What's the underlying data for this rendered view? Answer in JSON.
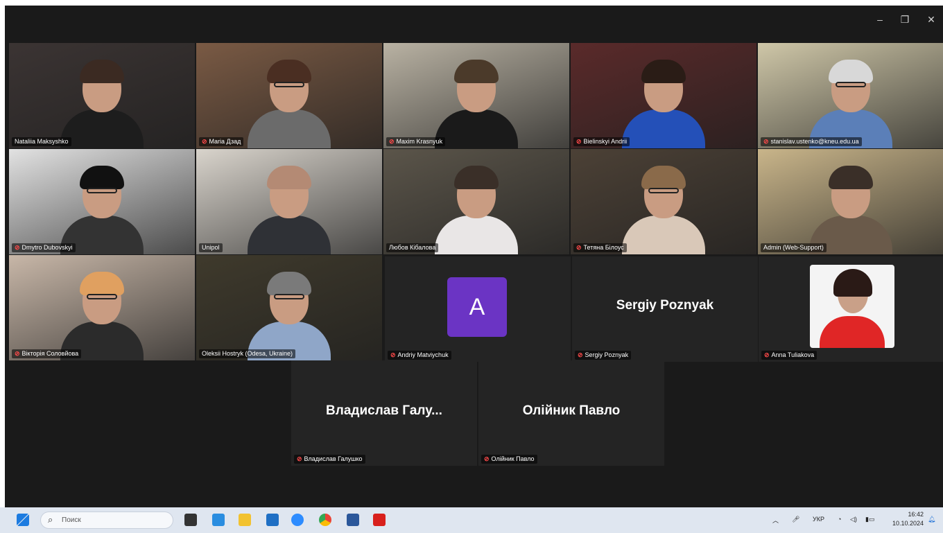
{
  "window": {
    "controls": [
      "–",
      "❐",
      "✕"
    ]
  },
  "participants": [
    {
      "name": "Nataliia Maksyshko",
      "muted": false,
      "active": false,
      "bg": "#3b3433",
      "hair": "#3b2a22",
      "shirt": "#1d1d1d",
      "glasses": false
    },
    {
      "name": "Maria Дзад",
      "muted": true,
      "active": false,
      "bg": "#7a5a44",
      "hair": "#4a2e22",
      "shirt": "#6b6b6b",
      "glasses": true
    },
    {
      "name": "Maxim Krasnyuk",
      "muted": true,
      "active": false,
      "bg": "#b9b2a3",
      "hair": "#4b3a2a",
      "shirt": "#1a1a1a",
      "glasses": false
    },
    {
      "name": "Bielinskyi Andrii",
      "muted": true,
      "active": false,
      "bg": "#5a2a2a",
      "hair": "#2a1c16",
      "shirt": "#2450b8",
      "glasses": false
    },
    {
      "name": "stanislav.ustenko@kneu.edu.ua",
      "muted": true,
      "active": false,
      "bg": "#cfc7a8",
      "hair": "#d8d8d8",
      "shirt": "#5b7fb8",
      "glasses": true
    },
    {
      "name": "Dmytro Dubovskyi",
      "muted": true,
      "active": false,
      "bg": "#e2e2e2",
      "hair": "#111111",
      "shirt": "#333333",
      "glasses": true
    },
    {
      "name": "Unipol",
      "muted": false,
      "active": true,
      "bg": "#d9d4cc",
      "hair": "#b48a74",
      "shirt": "#2f3136",
      "glasses": false
    },
    {
      "name": "Любов Кібалова",
      "muted": false,
      "active": false,
      "bg": "#5b554a",
      "hair": "#3a2f28",
      "shirt": "#e9e6e6",
      "glasses": false
    },
    {
      "name": "Тетяна Білоус",
      "muted": true,
      "active": false,
      "bg": "#4c4136",
      "hair": "#8a6a4a",
      "shirt": "#d9c8b8",
      "glasses": true
    },
    {
      "name": "Admin (Web-Support)",
      "muted": false,
      "active": false,
      "bg": "#c9b58a",
      "hair": "#3a2f28",
      "shirt": "#6a5a4a",
      "glasses": false
    },
    {
      "name": "Вікторія Соловйова",
      "muted": true,
      "active": false,
      "bg": "#c8b7a8",
      "hair": "#e0a060",
      "shirt": "#2b2b2b",
      "glasses": true
    },
    {
      "name": "Oleksii Hostryk (Odesa, Ukraine)",
      "muted": false,
      "active": false,
      "bg": "#3f3a2c",
      "hair": "#7a7a7a",
      "shirt": "#8fa6c8",
      "glasses": true
    }
  ],
  "avatar_tiles": [
    {
      "name": "Andriy Matviychuk",
      "letter": "A",
      "muted": true
    },
    {
      "name": "Sergiy Poznyak",
      "display": "Sergiy Poznyak",
      "muted": true
    },
    {
      "name": "Anna Tuliakova",
      "muted": true
    },
    {
      "name": "Владислав Галушко",
      "display": "Владислав Галу...",
      "muted": true
    },
    {
      "name": "Олійник Павло",
      "display": "Олійник Павло",
      "muted": true
    }
  ],
  "taskbar": {
    "search_placeholder": "Поиск",
    "tray_lang": "УКР",
    "time": "16:42",
    "date": "10.10.2024"
  }
}
